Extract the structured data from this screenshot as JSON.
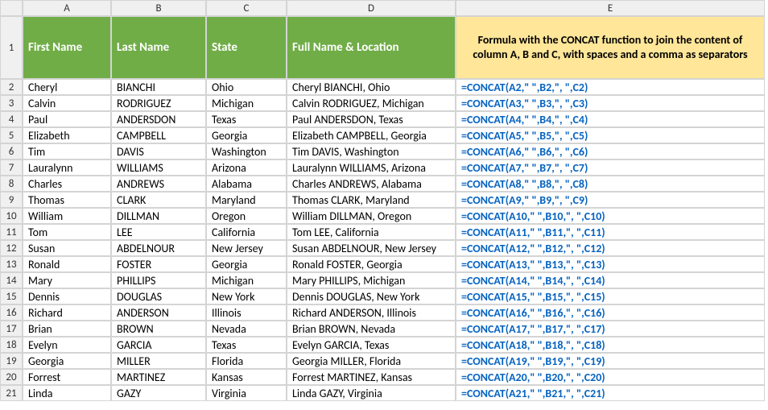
{
  "columns": [
    "A",
    "B",
    "C",
    "D",
    "E"
  ],
  "header_row_num": "1",
  "headers": {
    "A": "First Name",
    "B": "Last Name",
    "C": "State",
    "D": "Full Name & Location",
    "E": "Formula with the CONCAT function to join the content of column A, B and C, with spaces and a comma as separators"
  },
  "chart_data": {
    "type": "table",
    "rows": [
      {
        "n": "2",
        "first": "Cheryl",
        "last": "BIANCHI",
        "state": "Ohio",
        "full": "Cheryl BIANCHI, Ohio",
        "formula": "=CONCAT(A2,\" \",B2,\", \",C2)"
      },
      {
        "n": "3",
        "first": "Calvin",
        "last": "RODRIGUEZ",
        "state": "Michigan",
        "full": "Calvin RODRIGUEZ, Michigan",
        "formula": "=CONCAT(A3,\" \",B3,\", \",C3)"
      },
      {
        "n": "4",
        "first": "Paul",
        "last": "ANDERSDON",
        "state": "Texas",
        "full": "Paul ANDERSDON, Texas",
        "formula": "=CONCAT(A4,\" \",B4,\", \",C4)"
      },
      {
        "n": "5",
        "first": "Elizabeth",
        "last": "CAMPBELL",
        "state": "Georgia",
        "full": "Elizabeth CAMPBELL, Georgia",
        "formula": "=CONCAT(A5,\" \",B5,\", \",C5)"
      },
      {
        "n": "6",
        "first": "Tim",
        "last": "DAVIS",
        "state": "Washington",
        "full": "Tim DAVIS, Washington",
        "formula": "=CONCAT(A6,\" \",B6,\", \",C6)"
      },
      {
        "n": "7",
        "first": "Lauralynn",
        "last": "WILLIAMS",
        "state": "Arizona",
        "full": "Lauralynn WILLIAMS, Arizona",
        "formula": "=CONCAT(A7,\" \",B7,\", \",C7)"
      },
      {
        "n": "8",
        "first": "Charles",
        "last": "ANDREWS",
        "state": "Alabama",
        "full": "Charles ANDREWS, Alabama",
        "formula": "=CONCAT(A8,\" \",B8,\", \",C8)"
      },
      {
        "n": "9",
        "first": "Thomas",
        "last": "CLARK",
        "state": "Maryland",
        "full": "Thomas CLARK, Maryland",
        "formula": "=CONCAT(A9,\" \",B9,\", \",C9)"
      },
      {
        "n": "10",
        "first": "William",
        "last": "DILLMAN",
        "state": "Oregon",
        "full": "William DILLMAN, Oregon",
        "formula": "=CONCAT(A10,\" \",B10,\", \",C10)"
      },
      {
        "n": "11",
        "first": "Tom",
        "last": "LEE",
        "state": "California",
        "full": "Tom LEE, California",
        "formula": "=CONCAT(A11,\" \",B11,\", \",C11)"
      },
      {
        "n": "12",
        "first": "Susan",
        "last": "ABDELNOUR",
        "state": "New Jersey",
        "full": "Susan ABDELNOUR, New Jersey",
        "formula": "=CONCAT(A12,\" \",B12,\", \",C12)"
      },
      {
        "n": "13",
        "first": "Ronald",
        "last": "FOSTER",
        "state": "Georgia",
        "full": "Ronald FOSTER, Georgia",
        "formula": "=CONCAT(A13,\" \",B13,\", \",C13)"
      },
      {
        "n": "14",
        "first": "Mary",
        "last": "PHILLIPS",
        "state": "Michigan",
        "full": "Mary PHILLIPS, Michigan",
        "formula": "=CONCAT(A14,\" \",B14,\", \",C14)"
      },
      {
        "n": "15",
        "first": "Dennis",
        "last": "DOUGLAS",
        "state": "New York",
        "full": "Dennis DOUGLAS, New York",
        "formula": "=CONCAT(A15,\" \",B15,\", \",C15)"
      },
      {
        "n": "16",
        "first": "Richard",
        "last": "ANDERSON",
        "state": "Illinois",
        "full": "Richard ANDERSON, Illinois",
        "formula": "=CONCAT(A16,\" \",B16,\", \",C16)"
      },
      {
        "n": "17",
        "first": "Brian",
        "last": "BROWN",
        "state": "Nevada",
        "full": "Brian BROWN, Nevada",
        "formula": "=CONCAT(A17,\" \",B17,\", \",C17)"
      },
      {
        "n": "18",
        "first": "Evelyn",
        "last": "GARCIA",
        "state": "Texas",
        "full": "Evelyn GARCIA, Texas",
        "formula": "=CONCAT(A18,\" \",B18,\", \",C18)"
      },
      {
        "n": "19",
        "first": "Georgia",
        "last": "MILLER",
        "state": "Florida",
        "full": "Georgia MILLER, Florida",
        "formula": "=CONCAT(A19,\" \",B19,\", \",C19)"
      },
      {
        "n": "20",
        "first": "Forrest",
        "last": "MARTINEZ",
        "state": "Kansas",
        "full": "Forrest MARTINEZ, Kansas",
        "formula": "=CONCAT(A20,\" \",B20,\", \",C20)"
      },
      {
        "n": "21",
        "first": "Linda",
        "last": "GAZY",
        "state": "Virginia",
        "full": "Linda GAZY, Virginia",
        "formula": "=CONCAT(A21,\" \",B21,\", \",C21)"
      }
    ]
  }
}
